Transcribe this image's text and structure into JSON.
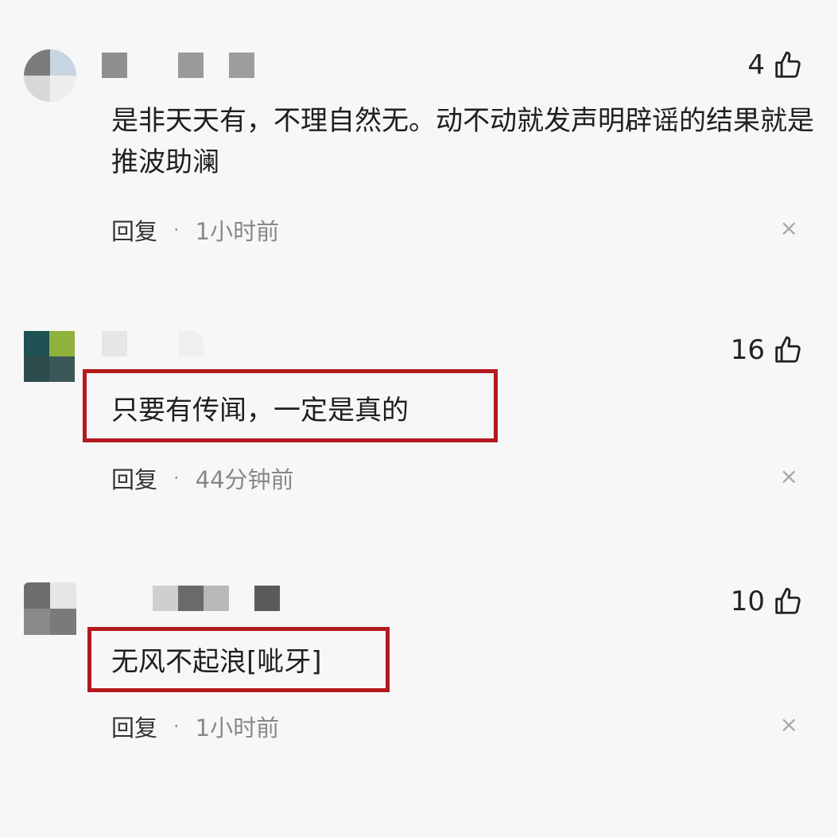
{
  "comments": [
    {
      "likes": "4",
      "text": "是非天天有，不理自然无。动不动就发声明辟谣的结果就是推波助澜",
      "reply_label": "回复",
      "separator": "·",
      "time": "1小时前",
      "close_glyph": "×",
      "avatar_colors": [
        "#7c7c7c",
        "#c7d6e2",
        "#d8d8d8",
        "#eeeeee"
      ],
      "name_block_colors": [
        "#8f8f8f",
        "#9a9a9a",
        "#9d9d9d"
      ]
    },
    {
      "likes": "16",
      "text": "只要有传闻，一定是真的",
      "reply_label": "回复",
      "separator": "·",
      "time": "44分钟前",
      "close_glyph": "×",
      "avatar_colors": [
        "#1f5252",
        "#8fb33c",
        "#2e4c4c",
        "#3a5858"
      ],
      "name_block_colors": [
        "#e6e6e6",
        "#efefef"
      ]
    },
    {
      "likes": "10",
      "text": "无风不起浪[呲牙]",
      "reply_label": "回复",
      "separator": "·",
      "time": "1小时前",
      "close_glyph": "×",
      "avatar_colors": [
        "#6d6d6d",
        "#e6e6e6",
        "#8a8a8a",
        "#7a7a7a"
      ],
      "name_block_colors": [
        "#cfcfcf",
        "#6a6a6a",
        "#b9b9b9",
        "#5a5a5a"
      ]
    }
  ],
  "highlight_color": "#b3191d",
  "icons": {
    "like": "thumbs-up-icon",
    "close": "close-icon"
  }
}
